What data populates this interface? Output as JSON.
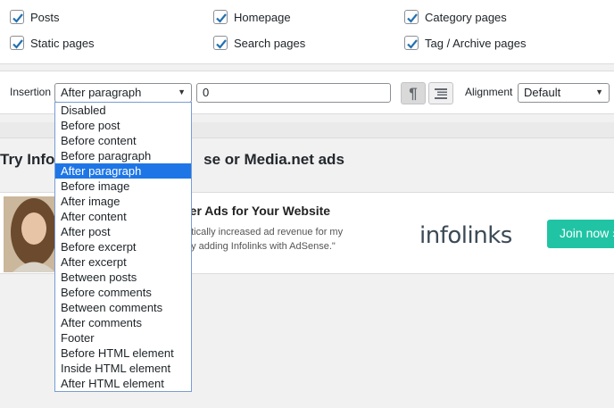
{
  "page_types": [
    {
      "label": "Posts",
      "checked": true
    },
    {
      "label": "Homepage",
      "checked": true
    },
    {
      "label": "Category pages",
      "checked": true
    },
    {
      "label": "Static pages",
      "checked": true
    },
    {
      "label": "Search pages",
      "checked": true
    },
    {
      "label": "Tag / Archive pages",
      "checked": true
    }
  ],
  "insertion": {
    "label": "Insertion",
    "selected": "After paragraph",
    "number_value": "0",
    "options": [
      "Disabled",
      "Before post",
      "Before content",
      "Before paragraph",
      "After paragraph",
      "Before image",
      "After image",
      "After content",
      "After post",
      "Before excerpt",
      "After excerpt",
      "Between posts",
      "Before comments",
      "Between comments",
      "After comments",
      "Footer",
      "Before HTML element",
      "Inside HTML element",
      "After HTML element"
    ]
  },
  "toolbar": {
    "paragraph_icon": "paragraph-icon",
    "list_icon": "list-icon"
  },
  "alignment": {
    "label": "Alignment",
    "selected": "Default"
  },
  "promo": {
    "title_visible": "Try Infol",
    "title_tail": "se or Media.net ads",
    "banner_heading": "ter Ads for Your Website",
    "banner_line1": "atically increased ad revenue for my",
    "banner_line2": "by adding Infolinks with AdSense.\"",
    "logo_text": "infolinks",
    "join_label": "Join now ›"
  },
  "colors": {
    "check": "#2271b1",
    "selected_option": "#1e76e6",
    "join_button": "#20c4a4"
  }
}
